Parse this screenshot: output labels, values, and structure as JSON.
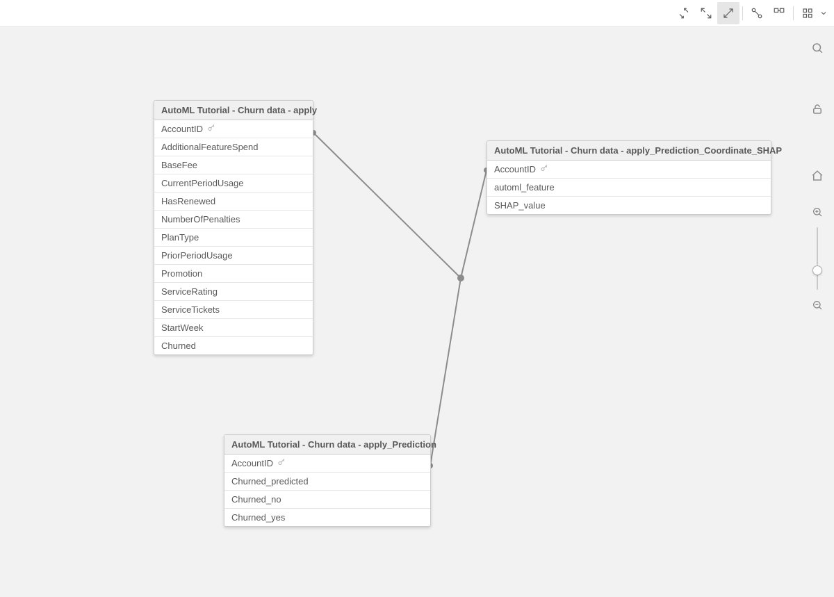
{
  "toolbar": {
    "collapse": "collapse",
    "fit": "fit",
    "expand_active": "expand",
    "layout1": "layout-a",
    "layout2": "layout-b",
    "grid": "grid",
    "grid_menu": "menu"
  },
  "rightRail": {
    "search": "search",
    "lock": "lock",
    "home": "home",
    "zoomIn": "zoom-in",
    "zoomOut": "zoom-out"
  },
  "tables": {
    "t1": {
      "title": "AutoML Tutorial - Churn data - apply",
      "fields": [
        {
          "name": "AccountID",
          "key": true
        },
        {
          "name": "AdditionalFeatureSpend",
          "key": false
        },
        {
          "name": "BaseFee",
          "key": false
        },
        {
          "name": "CurrentPeriodUsage",
          "key": false
        },
        {
          "name": "HasRenewed",
          "key": false
        },
        {
          "name": "NumberOfPenalties",
          "key": false
        },
        {
          "name": "PlanType",
          "key": false
        },
        {
          "name": "PriorPeriodUsage",
          "key": false
        },
        {
          "name": "Promotion",
          "key": false
        },
        {
          "name": "ServiceRating",
          "key": false
        },
        {
          "name": "ServiceTickets",
          "key": false
        },
        {
          "name": "StartWeek",
          "key": false
        },
        {
          "name": "Churned",
          "key": false
        }
      ]
    },
    "t2": {
      "title": "AutoML Tutorial - Churn data - apply_Prediction_Coordinate_SHAP",
      "fields": [
        {
          "name": "AccountID",
          "key": true
        },
        {
          "name": "automl_feature",
          "key": false
        },
        {
          "name": "SHAP_value",
          "key": false
        }
      ]
    },
    "t3": {
      "title": "AutoML Tutorial - Churn data - apply_Prediction",
      "fields": [
        {
          "name": "AccountID",
          "key": true
        },
        {
          "name": "Churned_predicted",
          "key": false
        },
        {
          "name": "Churned_no",
          "key": false
        },
        {
          "name": "Churned_yes",
          "key": false
        }
      ]
    }
  }
}
